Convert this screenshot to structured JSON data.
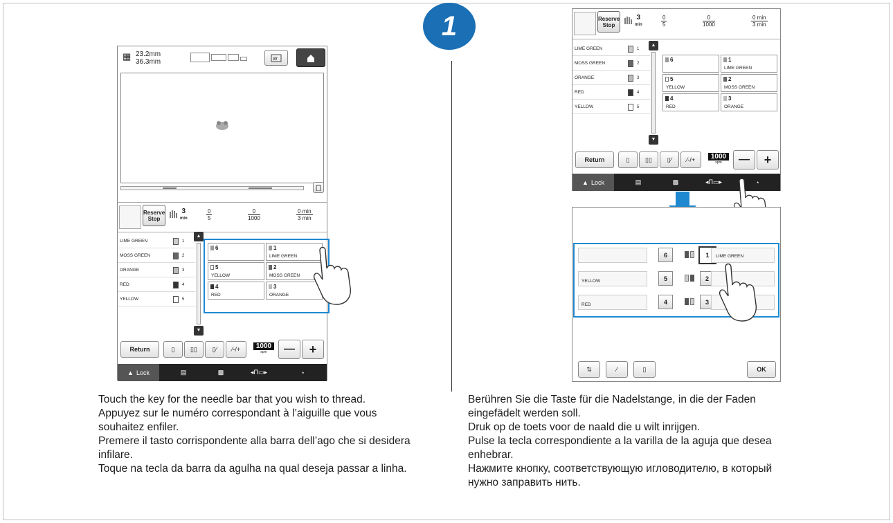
{
  "step_number": "1",
  "left_screen": {
    "dimensions": {
      "width": "23.2mm",
      "height": "36.3mm"
    },
    "thread_info": {
      "reserve_stop_label": "Reserve\nStop",
      "speed_value": "3",
      "speed_unit": "min",
      "counter1": {
        "top": "0",
        "bottom": "5"
      },
      "counter2": {
        "top": "0",
        "bottom": "1000"
      },
      "counter3": {
        "top": "0 min",
        "bottom": "3 min"
      }
    },
    "color_list": [
      {
        "name": "LIME GREEN",
        "number": "1"
      },
      {
        "name": "MOSS GREEN",
        "number": "2"
      },
      {
        "name": "ORANGE",
        "number": "3"
      },
      {
        "name": "RED",
        "number": "4"
      },
      {
        "name": "YELLOW",
        "number": "5"
      }
    ],
    "needle_grid": [
      {
        "number": "6",
        "color": ""
      },
      {
        "number": "1",
        "color": "LIME GREEN"
      },
      {
        "number": "5",
        "color": "YELLOW"
      },
      {
        "number": "2",
        "color": "MOSS GREEN"
      },
      {
        "number": "4",
        "color": "RED"
      },
      {
        "number": "3",
        "color": "ORANGE"
      }
    ],
    "return_label": "Return",
    "speed_display": "1000",
    "speed_display_unit": "spm",
    "minus_label": "—",
    "plus_label": "+",
    "lock_label": "Lock"
  },
  "right_screen": {
    "thread_info": {
      "reserve_stop_label": "Reserve\nStop",
      "speed_value": "3",
      "speed_unit": "min",
      "counter1": {
        "top": "0",
        "bottom": "5"
      },
      "counter2": {
        "top": "0",
        "bottom": "1000"
      },
      "counter3": {
        "top": "0 min",
        "bottom": "3 min"
      }
    },
    "color_list": [
      {
        "name": "LIME GREEN",
        "number": "1"
      },
      {
        "name": "MOSS GREEN",
        "number": "2"
      },
      {
        "name": "ORANGE",
        "number": "3"
      },
      {
        "name": "RED",
        "number": "4"
      },
      {
        "name": "YELLOW",
        "number": "5"
      }
    ],
    "needle_grid": [
      {
        "number": "6",
        "color": ""
      },
      {
        "number": "1",
        "color": "LIME GREEN"
      },
      {
        "number": "5",
        "color": "YELLOW"
      },
      {
        "number": "2",
        "color": "MOSS GREEN"
      },
      {
        "number": "4",
        "color": "RED"
      },
      {
        "number": "3",
        "color": "ORANGE"
      }
    ],
    "return_label": "Return",
    "speed_display": "1000",
    "speed_display_unit": "spm",
    "minus_label": "—",
    "plus_label": "+",
    "lock_label": "Lock"
  },
  "dialog": {
    "rows": [
      {
        "left_label": "",
        "left_key": "6",
        "right_key": "1",
        "right_label": "LIME GREEN"
      },
      {
        "left_label": "YELLOW",
        "left_key": "5",
        "right_key": "2",
        "right_label": ""
      },
      {
        "left_label": "RED",
        "left_key": "4",
        "right_key": "3",
        "right_label": ""
      }
    ],
    "ok_label": "OK"
  },
  "captions": {
    "left": [
      "Touch the key for the needle bar that you wish to thread.",
      "Appuyez sur le numéro correspondant à l’aiguille que vous",
      "souhaitez enfiler.",
      "Premere il tasto corrispondente alla barra dell’ago che si desidera",
      "infilare.",
      "Toque na tecla da barra da agulha na qual deseja passar a linha."
    ],
    "right": [
      "Berühren Sie die Taste für die Nadelstange, in die der Faden",
      "eingefädelt werden soll.",
      "Druk op de toets voor de naald die u wilt inrijgen.",
      "Pulse la tecla correspondiente a la varilla de la aguja que desea",
      "enhebrar.",
      "Нажмите кнопку, соответствующую игловодителю, в который",
      "нужно заправить нить."
    ]
  },
  "colors": {
    "accent": "#1e88d0",
    "badge": "#1a6fb5",
    "statusbar": "#222222"
  }
}
